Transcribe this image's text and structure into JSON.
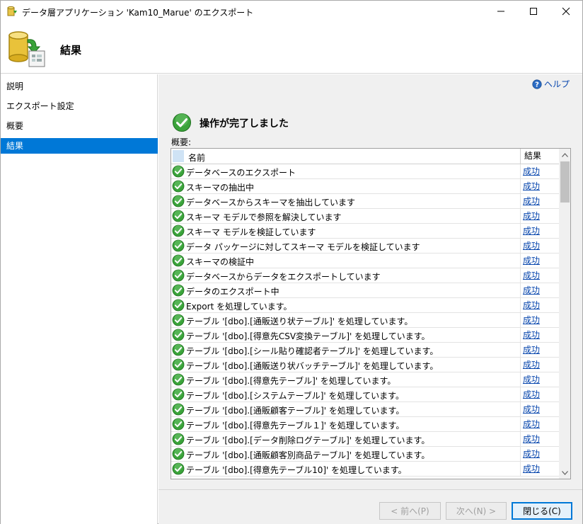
{
  "window": {
    "title": "データ層アプリケーション 'Kam10_Marue' のエクスポート"
  },
  "header": {
    "title": "結果"
  },
  "sidebar": {
    "items": [
      {
        "label": "説明"
      },
      {
        "label": "エクスポート設定"
      },
      {
        "label": "概要"
      },
      {
        "label": "結果"
      }
    ]
  },
  "main": {
    "help_label": "ヘルプ",
    "status_text": "操作が完了しました",
    "summary_label": "概要:",
    "columns": {
      "name": "名前",
      "result": "結果"
    },
    "rows": [
      {
        "name": "データベースのエクスポート",
        "result": "成功"
      },
      {
        "name": "スキーマの抽出中",
        "result": "成功"
      },
      {
        "name": "データベースからスキーマを抽出しています",
        "result": "成功"
      },
      {
        "name": "スキーマ モデルで参照を解決しています",
        "result": "成功"
      },
      {
        "name": "スキーマ モデルを検証しています",
        "result": "成功"
      },
      {
        "name": "データ パッケージに対してスキーマ モデルを検証しています",
        "result": "成功"
      },
      {
        "name": "スキーマの検証中",
        "result": "成功"
      },
      {
        "name": "データベースからデータをエクスポートしています",
        "result": "成功"
      },
      {
        "name": "データのエクスポート中",
        "result": "成功"
      },
      {
        "name": "Export を処理しています。",
        "result": "成功"
      },
      {
        "name": "テーブル '[dbo].[通販送り状テーブル]' を処理しています。",
        "result": "成功"
      },
      {
        "name": "テーブル '[dbo].[得意先CSV変換テーブル]' を処理しています。",
        "result": "成功"
      },
      {
        "name": "テーブル '[dbo].[シール貼り確認者テーブル]' を処理しています。",
        "result": "成功"
      },
      {
        "name": "テーブル '[dbo].[通販送り状バッチテーブル]' を処理しています。",
        "result": "成功"
      },
      {
        "name": "テーブル '[dbo].[得意先テーブル]' を処理しています。",
        "result": "成功"
      },
      {
        "name": "テーブル '[dbo].[システムテーブル]' を処理しています。",
        "result": "成功"
      },
      {
        "name": "テーブル '[dbo].[通販顧客テーブル]' を処理しています。",
        "result": "成功"
      },
      {
        "name": "テーブル '[dbo].[得意先テーブル１]' を処理しています。",
        "result": "成功"
      },
      {
        "name": "テーブル '[dbo].[データ削除ログテーブル]' を処理しています。",
        "result": "成功"
      },
      {
        "name": "テーブル '[dbo].[通販顧客別商品テーブル]' を処理しています。",
        "result": "成功"
      },
      {
        "name": "テーブル '[dbo].[得意先テーブル10]' を処理しています。",
        "result": "成功"
      }
    ]
  },
  "footer": {
    "prev_label": "< 前へ(P)",
    "next_label": "次へ(N) >",
    "close_label": "閉じる(C)"
  },
  "colors": {
    "accent": "#0078d7",
    "link": "#0645ad",
    "success": "#3aa33a"
  }
}
